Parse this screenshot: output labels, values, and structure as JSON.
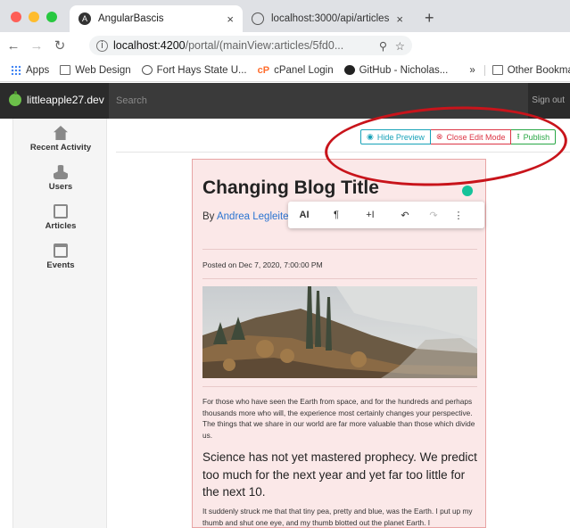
{
  "browser": {
    "tabs": [
      {
        "label": "AngularBascis",
        "close": "×"
      },
      {
        "label": "localhost:3000/api/articles",
        "close": "×"
      }
    ],
    "new_tab": "+",
    "url_host": "localhost:4200",
    "url_path": "/portal/(mainView:articles/5fd0...",
    "bookmarks": [
      "Apps",
      "Web Design",
      "Fort Hays State U...",
      "cPanel Login",
      "GitHub - Nicholas..."
    ],
    "bookmarks_overflow": "»",
    "other_bookmarks": "Other Bookmarks"
  },
  "app": {
    "brand": "littleapple27.dev",
    "search_placeholder": "Search",
    "sign_out": "Sign out"
  },
  "sidebar": {
    "items": [
      {
        "label": "Recent Activity",
        "icon": "home-icon"
      },
      {
        "label": "Users",
        "icon": "user-icon"
      },
      {
        "label": "Articles",
        "icon": "article-icon"
      },
      {
        "label": "Events",
        "icon": "calendar-icon"
      }
    ]
  },
  "toolbar": {
    "hide_preview": "Hide Preview",
    "close_edit": "Close Edit Mode",
    "publish": "Publish"
  },
  "colors": {
    "info": "#17a2b8",
    "danger": "#dc3545",
    "success": "#28a745",
    "annotation": "#c8141b"
  },
  "editor_toolbar": {
    "items": [
      "AI",
      "¶",
      "+I",
      "↶",
      "↷",
      "⋮"
    ]
  },
  "article": {
    "title": "Changing Blog Title",
    "by": "By ",
    "author": "Andrea Legleiter",
    "posted": "Posted on Dec 7, 2020, 7:00:00 PM",
    "paragraph1": "For those who have seen the Earth from space, and for the hundreds and perhaps thousands more who will, the experience most certainly changes your perspective. The things that we share in our world are far more valuable than those which divide us.",
    "quote": "Science has not yet mastered prophecy. We predict too much for the next year and yet far too little for the next 10.",
    "paragraph2": "It suddenly struck me that that tiny pea, pretty and blue, was the Earth. I put up my thumb and shut one eye, and my thumb blotted out the planet Earth. I"
  }
}
